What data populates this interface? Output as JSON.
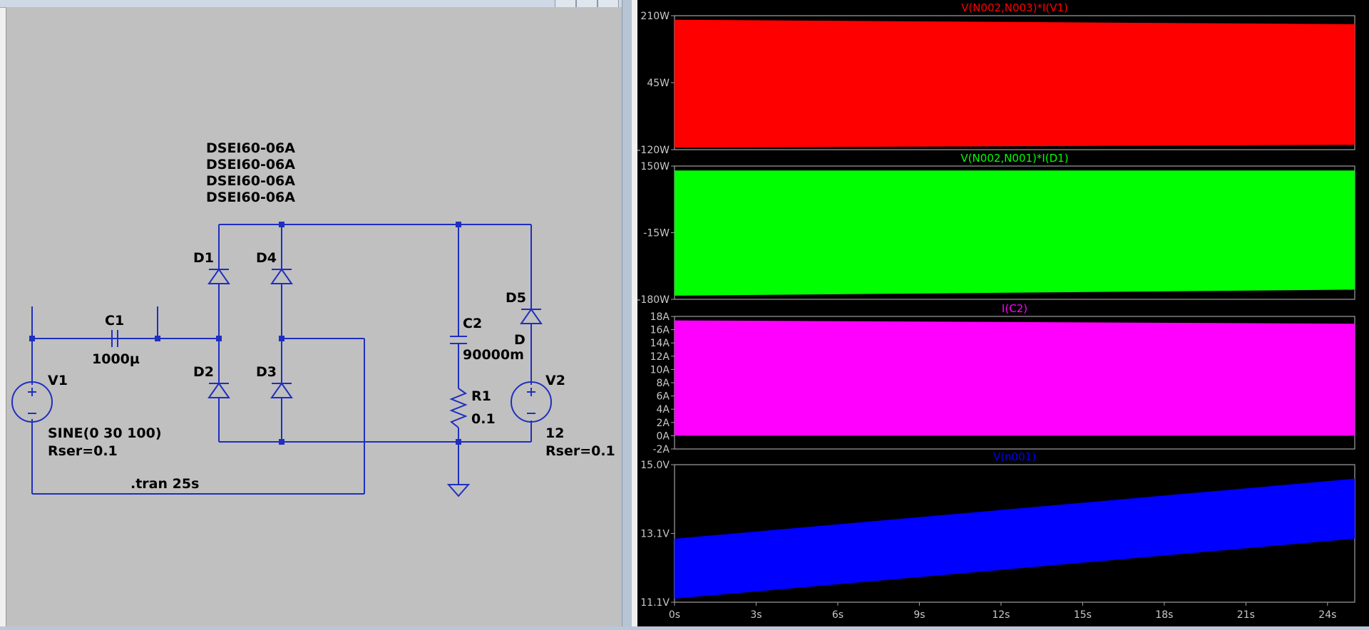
{
  "schematic": {
    "directive": ".tran 25s",
    "diode_models": [
      "DSEI60-06A",
      "DSEI60-06A",
      "DSEI60-06A",
      "DSEI60-06A"
    ],
    "components": {
      "V1": {
        "name": "V1",
        "value": "SINE(0 30 100)",
        "extra": "Rser=0.1"
      },
      "C1": {
        "name": "C1",
        "value": "1000µ"
      },
      "D1": {
        "name": "D1"
      },
      "D2": {
        "name": "D2"
      },
      "D3": {
        "name": "D3"
      },
      "D4": {
        "name": "D4"
      },
      "D5": {
        "name": "D5",
        "value": "D"
      },
      "C2": {
        "name": "C2",
        "value": "90000m"
      },
      "R1": {
        "name": "R1",
        "value": "0.1"
      },
      "V2": {
        "name": "V2",
        "value": "12",
        "extra": "Rser=0.1"
      }
    },
    "colors": {
      "wire": "#1f2fbf",
      "text": "#000000",
      "background": "#c0c0c0"
    }
  },
  "waveform": {
    "x_ticks": [
      "0s",
      "3s",
      "6s",
      "9s",
      "12s",
      "15s",
      "18s",
      "21s",
      "24s"
    ],
    "colors": {
      "background": "#000000",
      "axis": "#a0a0a0",
      "tick_text": "#c8c8c8"
    }
  },
  "chart_data": [
    {
      "type": "area",
      "trace": "V(N002,N003)*I(V1)",
      "color": "#ff0000",
      "y_ticks": [
        "210W",
        "45W",
        "-120W"
      ],
      "ylim": [
        -120,
        210
      ],
      "x": [
        0,
        25
      ],
      "upper": [
        200,
        189
      ],
      "lower": [
        -115,
        -108
      ]
    },
    {
      "type": "area",
      "trace": "V(N002,N001)*I(D1)",
      "color": "#00ff00",
      "y_ticks": [
        "150W",
        "-15W",
        "-180W"
      ],
      "ylim": [
        -180,
        150
      ],
      "x": [
        0,
        25
      ],
      "upper": [
        139,
        139
      ],
      "lower": [
        -171,
        -156
      ]
    },
    {
      "type": "area",
      "trace": "I(C2)",
      "color": "#ff00ff",
      "y_ticks": [
        "18A",
        "16A",
        "14A",
        "12A",
        "10A",
        "8A",
        "6A",
        "4A",
        "2A",
        "0A",
        "-2A"
      ],
      "ylim": [
        -2,
        18
      ],
      "x": [
        0,
        25
      ],
      "upper": [
        17.4,
        16.9
      ],
      "lower": [
        0,
        0
      ]
    },
    {
      "type": "area",
      "trace": "V(n001)",
      "color": "#0000ff",
      "y_ticks": [
        "15.0V",
        "13.1V",
        "11.1V"
      ],
      "ylim": [
        11.1,
        15.0
      ],
      "x": [
        0,
        25
      ],
      "upper": [
        12.9,
        14.6
      ],
      "lower": [
        11.2,
        12.9
      ]
    }
  ]
}
